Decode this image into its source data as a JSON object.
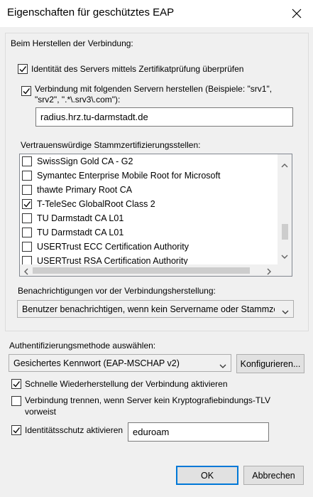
{
  "window": {
    "title": "Eigenschaften für geschütztes EAP"
  },
  "connection_group": {
    "label": "Beim Herstellen der Verbindung:",
    "verify_cert": {
      "label": "Identität des Servers mittels Zertifikatprüfung überprüfen",
      "checked": true
    },
    "connect_servers": {
      "label_line1": "Verbindung mit folgenden Servern herstellen (Beispiele: \"srv1\",",
      "label_line2": "\"srv2\", \".*\\.srv3\\.com\"):",
      "checked": true
    },
    "server_names": "radius.hrz.tu-darmstadt.de",
    "trusted_ca_label": "Vertrauenswürdige Stammzertifizierungsstellen:",
    "ca_list": [
      {
        "label": "SwissSign Gold CA - G2",
        "checked": false
      },
      {
        "label": "Symantec Enterprise Mobile Root for Microsoft",
        "checked": false
      },
      {
        "label": "thawte Primary Root CA",
        "checked": false
      },
      {
        "label": "T-TeleSec GlobalRoot Class 2",
        "checked": true
      },
      {
        "label": "TU Darmstadt CA L01",
        "checked": false
      },
      {
        "label": "TU Darmstadt CA L01",
        "checked": false
      },
      {
        "label": "USERTrust ECC Certification Authority",
        "checked": false
      },
      {
        "label": "USERTrust RSA Certification Authority",
        "checked": false
      }
    ],
    "notifications_label": "Benachrichtigungen vor der Verbindungsherstellung:",
    "notifications_value": "Benutzer benachrichtigen, wenn kein Servername oder Stammzertifikat angegeben ist"
  },
  "auth": {
    "label": "Authentifizierungsmethode auswählen:",
    "method_value": "Gesichertes Kennwort (EAP-MSCHAP v2)",
    "configure_button": "Konfigurieren..."
  },
  "options": {
    "fast_reconnect": {
      "label": "Schnelle Wiederherstellung der Verbindung aktivieren",
      "checked": true
    },
    "disconnect_tlv": {
      "label_line1": "Verbindung trennen, wenn Server kein Kryptografiebindungs-TLV",
      "label_line2": "vorweist",
      "checked": false
    },
    "identity_privacy": {
      "label": "Identitätsschutz aktivieren",
      "checked": true,
      "value": "eduroam"
    }
  },
  "buttons": {
    "ok": "OK",
    "cancel": "Abbrechen"
  }
}
